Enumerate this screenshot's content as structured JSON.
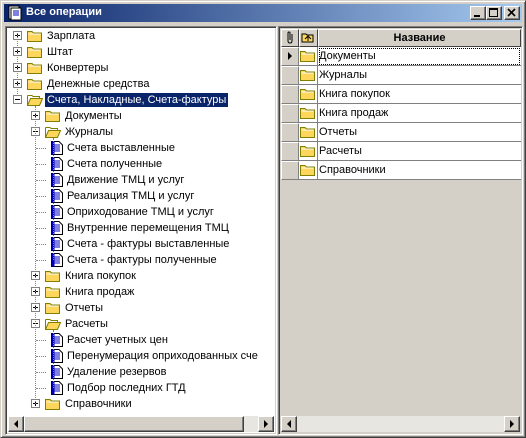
{
  "window": {
    "title": "Все операции",
    "controls": {
      "minimize": "_",
      "maximize": "□",
      "close": "×"
    }
  },
  "tree": {
    "items": [
      {
        "label": "Зарплата",
        "level": 0,
        "state": "closed",
        "type": "folder"
      },
      {
        "label": "Штат",
        "level": 0,
        "state": "closed",
        "type": "folder"
      },
      {
        "label": "Конвертеры",
        "level": 0,
        "state": "closed",
        "type": "folder"
      },
      {
        "label": "Денежные средства",
        "level": 0,
        "state": "closed",
        "type": "folder"
      },
      {
        "label": "Счета, Накладные, Счета-фактуры",
        "level": 0,
        "state": "open",
        "type": "folder",
        "selected": true
      },
      {
        "label": "Документы",
        "level": 1,
        "state": "closed",
        "type": "folder"
      },
      {
        "label": "Журналы",
        "level": 1,
        "state": "open",
        "type": "folder"
      },
      {
        "label": "Счета выставленные",
        "level": 2,
        "type": "doc"
      },
      {
        "label": "Счета полученные",
        "level": 2,
        "type": "doc"
      },
      {
        "label": "Движение ТМЦ и услуг",
        "level": 2,
        "type": "doc"
      },
      {
        "label": "Реализация ТМЦ и услуг",
        "level": 2,
        "type": "doc"
      },
      {
        "label": "Оприходование ТМЦ и услуг",
        "level": 2,
        "type": "doc"
      },
      {
        "label": "Внутренние перемещения ТМЦ",
        "level": 2,
        "type": "doc"
      },
      {
        "label": "Счета - фактуры выставленные",
        "level": 2,
        "type": "doc"
      },
      {
        "label": "Счета - фактуры полученные",
        "level": 2,
        "type": "doc"
      },
      {
        "label": "Книга покупок",
        "level": 1,
        "state": "closed",
        "type": "folder"
      },
      {
        "label": "Книга продаж",
        "level": 1,
        "state": "closed",
        "type": "folder"
      },
      {
        "label": "Отчеты",
        "level": 1,
        "state": "closed",
        "type": "folder"
      },
      {
        "label": "Расчеты",
        "level": 1,
        "state": "open",
        "type": "folder"
      },
      {
        "label": "Расчет учетных цен",
        "level": 2,
        "type": "doc"
      },
      {
        "label": "Перенумерация оприходованных сче",
        "level": 2,
        "type": "doc"
      },
      {
        "label": "Удаление резервов",
        "level": 2,
        "type": "doc"
      },
      {
        "label": "Подбор последних ГТД",
        "level": 2,
        "type": "doc"
      },
      {
        "label": "Справочники",
        "level": 1,
        "state": "closed",
        "type": "folder"
      }
    ]
  },
  "grid": {
    "header": {
      "name": "Название"
    },
    "rows": [
      {
        "name": "Документы",
        "current": true
      },
      {
        "name": "Журналы"
      },
      {
        "name": "Книга покупок"
      },
      {
        "name": "Книга продаж"
      },
      {
        "name": "Отчеты"
      },
      {
        "name": "Расчеты"
      },
      {
        "name": "Справочники"
      }
    ]
  },
  "colors": {
    "titlebar_start": "#0a246a",
    "titlebar_end": "#a6caf0",
    "selection": "#0a246a",
    "folder": "#ffd65c",
    "doc_accent": "#0000c0"
  }
}
